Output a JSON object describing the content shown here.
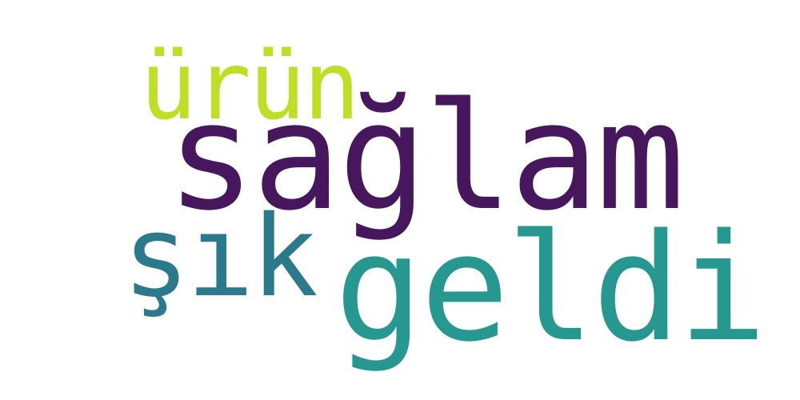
{
  "words": [
    {
      "text": "sağlam",
      "color": "#47175e"
    },
    {
      "text": "ürün",
      "color": "#bddf26"
    },
    {
      "text": "şık",
      "color": "#2b7a8c"
    },
    {
      "text": "geldi",
      "color": "#26988f"
    }
  ]
}
